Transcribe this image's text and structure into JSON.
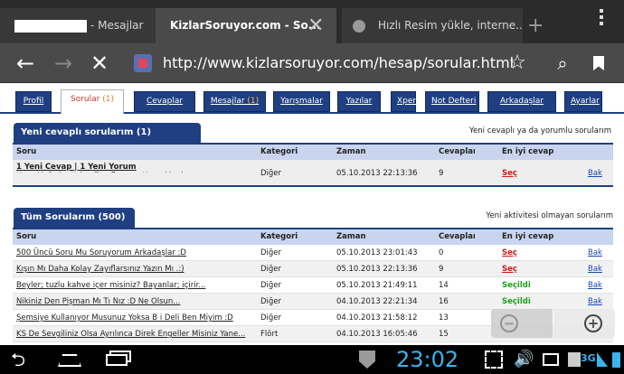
{
  "browser": {
    "tabs": [
      {
        "title": "- Mesajlar",
        "active": false
      },
      {
        "title": "KizlarSoruyor.com - So...",
        "active": true
      },
      {
        "title": "Hızlı Resim yükle, interne...",
        "active": false
      }
    ],
    "url": "http://www.kizlarsoruyor.com/hesap/sorular.html"
  },
  "nav": {
    "tabs": [
      {
        "label": "Profil",
        "count": ""
      },
      {
        "label": "Sorular",
        "count": "(1)"
      },
      {
        "label": "Cevaplar",
        "count": ""
      },
      {
        "label": "Mesajlar",
        "count": "(1)"
      },
      {
        "label": "Yarışmalar",
        "count": ""
      },
      {
        "label": "Yazılar",
        "count": ""
      },
      {
        "label": "Xper",
        "count": ""
      },
      {
        "label": "Not Defteri",
        "count": ""
      },
      {
        "label": "Arkadaşlar",
        "count": ""
      },
      {
        "label": "Ayarlar",
        "count": ""
      }
    ],
    "active_index": 1
  },
  "columns": {
    "soru": "Soru",
    "kategori": "Kategori",
    "zaman": "Zaman",
    "cevaplar": "Cevaplar",
    "en_iyi": "En iyi cevap"
  },
  "recent": {
    "title": "Yeni cevaplı sorularım (1)",
    "note": "Yeni cevaplı ya da yorumlu sorularım",
    "rows": [
      {
        "soru": "Kışın Mı Daha Kolay Zayıflarsınız Yazın Mı .:)",
        "sub": "1 Yeni Cevap | 1 Yeni Yorum",
        "kategori": "Diğer",
        "zaman": "05.10.2013 22:13:36",
        "cevaplar": "9",
        "en_iyi": "Seç",
        "bak": "Bak"
      }
    ]
  },
  "all": {
    "title": "Tüm Sorularım (500)",
    "note": "Yeni aktivitesi olmayan sorularım",
    "rows": [
      {
        "soru": "500 Üncü Soru Mu Soruyorum Arkadaşlar :D",
        "kategori": "Diğer",
        "zaman": "05.10.2013 23:01:43",
        "cevaplar": "0",
        "en_iyi": "Seç",
        "bak": "Bak"
      },
      {
        "soru": "Kışın Mı Daha Kolay Zayıflarsınız Yazın Mı .:)",
        "kategori": "Diğer",
        "zaman": "05.10.2013 22:13:36",
        "cevaplar": "9",
        "en_iyi": "Seç",
        "bak": "Bak"
      },
      {
        "soru": "Beyler; tuzlu kahve içer misiniz? Bayanlar; içirir...",
        "kategori": "Diğer",
        "zaman": "05.10.2013 21:49:11",
        "cevaplar": "14",
        "en_iyi": "Seçildi",
        "bak": "Bak"
      },
      {
        "soru": "Nikiniz Den Pişman Mı Tı Nız :D Ne Olsun...",
        "kategori": "Diğer",
        "zaman": "04.10.2013 22:21:34",
        "cevaplar": "16",
        "en_iyi": "Seçildi",
        "bak": "Bak"
      },
      {
        "soru": "Şemsiye Kullanıyor Musunuz Yoksa B i Deli Ben Miyim :D",
        "kategori": "Diğer",
        "zaman": "04.10.2013 21:58:12",
        "cevaplar": "13",
        "en_iyi": "",
        "bak": ""
      },
      {
        "soru": "KS De Sevgiliniz Olsa Ayrılınca Direk Engeller Misiniz Yane...",
        "kategori": "Flört",
        "zaman": "04.10.2013 16:05:46",
        "cevaplar": "15",
        "en_iyi": "",
        "bak": ""
      }
    ]
  },
  "system": {
    "clock": "23:02",
    "network": "3G"
  },
  "colors": {
    "nav_blue": "#1f3f82",
    "header_row": "#c9d5ee",
    "select_red": "#d01818",
    "selected_green": "#19a31b",
    "clock_blue": "#3ab4ea"
  },
  "icons": [
    "back-arrow-icon",
    "forward-arrow-icon",
    "stop-icon",
    "star-icon",
    "search-icon",
    "bookmarks-icon",
    "zoom-out-icon",
    "zoom-in-icon",
    "nav-back-icon",
    "nav-home-icon",
    "nav-recent-icon",
    "screenshot-icon",
    "volume-icon",
    "signal-icon",
    "battery-icon"
  ]
}
